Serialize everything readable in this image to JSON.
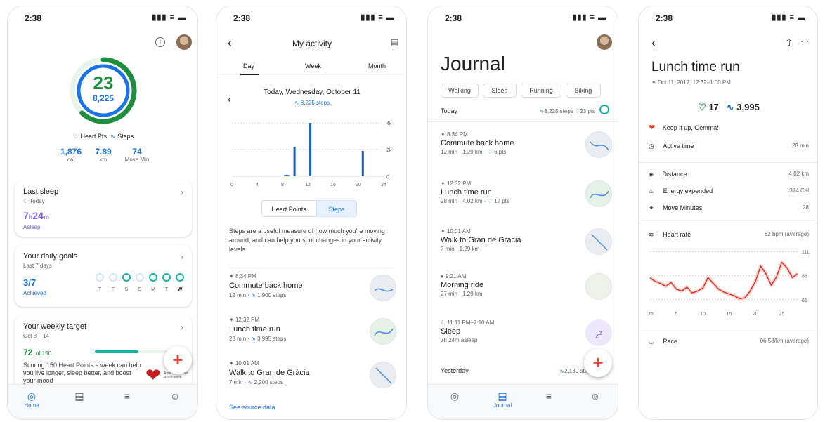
{
  "status": {
    "time": "2:38",
    "signal": "▮▮▮ ≡ ▬"
  },
  "home": {
    "ring": {
      "heart_pts": "23",
      "steps": "8,225",
      "heart_frac": 0.62,
      "steps_frac": 0.99
    },
    "legend": {
      "heart": "Heart Pts",
      "steps": "Steps"
    },
    "stats": [
      {
        "value": "1,876",
        "unit": "cal"
      },
      {
        "value": "7.89",
        "unit": "km"
      },
      {
        "value": "74",
        "unit": "Move Min"
      }
    ],
    "sleep": {
      "title": "Last sleep",
      "sub": "Today",
      "hours": "7",
      "h": "h",
      "mins": "24",
      "m": "m",
      "status": "Asleep"
    },
    "goals": {
      "title": "Your daily goals",
      "sub": "Last 7 days",
      "value": "3/7",
      "status": "Achieved",
      "days": [
        "T",
        "F",
        "S",
        "S",
        "M",
        "T",
        "W"
      ]
    },
    "weekly": {
      "title": "Your weekly target",
      "sub": "Oct 8 – 14",
      "value": "72",
      "of": "of 150",
      "progress": 0.48,
      "text": "Scoring 150 Heart Points a week can help you live longer, sleep better, and boost your mood",
      "logo_text": "American Heart Association"
    },
    "nav": {
      "home": "Home"
    }
  },
  "activity": {
    "title": "My activity",
    "tabs": [
      "Day",
      "Week",
      "Month"
    ],
    "date": "Today, Wednesday, October 11",
    "steps_summary": "8,225 steps",
    "chart_data": {
      "type": "bar",
      "x_ticks": [
        "0",
        "4",
        "8",
        "12",
        "16",
        "20",
        "24"
      ],
      "y_ticks": [
        "4k",
        "2k",
        "0"
      ],
      "ylim": [
        0,
        4000
      ],
      "hours": [
        8.4,
        8.7,
        9.0,
        9.9,
        12.4,
        20.7
      ],
      "values": [
        90,
        110,
        80,
        2200,
        3995,
        1900
      ]
    },
    "toggle": [
      "Heart Points",
      "Steps"
    ],
    "desc": "Steps are a useful measure of how much you're moving around, and can help you spot changes in your activity levels",
    "items": [
      {
        "time": "8:34 PM",
        "name": "Commute back home",
        "meta": "12 min · ",
        "steps": "1,900 steps"
      },
      {
        "time": "12:32 PM",
        "name": "Lunch time run",
        "meta": "28 min · ",
        "steps": "3,995 steps"
      },
      {
        "time": "10:01 AM",
        "name": "Walk to Gran de Gràcia",
        "meta": "7 min · ",
        "steps": "2,200 steps"
      }
    ],
    "source_link": "See source data"
  },
  "journal": {
    "title": "Journal",
    "chips": [
      "Walking",
      "Sleep",
      "Running",
      "Biking"
    ],
    "today": {
      "label": "Today",
      "steps": "8,225 steps",
      "pts": "23 pts"
    },
    "entries": [
      {
        "time": "8:34 PM",
        "name": "Commute back home",
        "meta": "12 min · 1.29 km · ",
        "pts": "6 pts"
      },
      {
        "time": "12:32 PM",
        "name": "Lunch time run",
        "meta": "28 min · 4.02 km · ",
        "pts": "17 pts"
      },
      {
        "time": "10:01 AM",
        "name": "Walk to Gran de Gràcia",
        "meta": "7 min · 1.29 km",
        "pts": ""
      },
      {
        "time": "9:21 AM",
        "name": "Morning ride",
        "meta": "27 min · 1.29 km",
        "pts": ""
      },
      {
        "time": "11:11 PM–7:10 AM",
        "name": "Sleep",
        "meta": "7h 24m asleep",
        "pts": ""
      }
    ],
    "yesterday": {
      "label": "Yesterday",
      "steps": "2,130 steps",
      "pts": "0 p"
    },
    "nav": {
      "journal": "Journal"
    }
  },
  "detail": {
    "title": "Lunch time run",
    "date": "Oct 11, 2017, 12:32–1:00 PM",
    "pts": "17",
    "steps": "3,995",
    "keep": "Keep it up, Gemma!",
    "rows": [
      {
        "label": "Active time",
        "value": "28 min"
      },
      {
        "label": "Distance",
        "value": "4.02 km"
      },
      {
        "label": "Energy expended",
        "value": "374 Cal"
      },
      {
        "label": "Move Minutes",
        "value": "28"
      }
    ],
    "heart": {
      "label": "Heart rate",
      "avg": "82 bpm (average)",
      "chart_data": {
        "type": "line",
        "x_ticks": [
          "0m",
          "5",
          "10",
          "15",
          "20",
          "25"
        ],
        "y_ticks": [
          "111",
          "86",
          "61"
        ],
        "xlim": [
          0,
          28
        ],
        "ylim": [
          55,
          115
        ],
        "values": [
          84,
          80,
          78,
          75,
          79,
          72,
          70,
          74,
          68,
          70,
          73,
          84,
          78,
          72,
          69,
          67,
          65,
          62,
          63,
          70,
          80,
          96,
          88,
          76,
          85,
          100,
          94,
          84,
          88
        ]
      }
    },
    "pace": {
      "label": "Pace",
      "value": "06:58/km (average)"
    }
  },
  "colors": {
    "green": "#1e8e3e",
    "teal": "#12b5a6",
    "blue": "#1a73e8",
    "red": "#d93025"
  }
}
